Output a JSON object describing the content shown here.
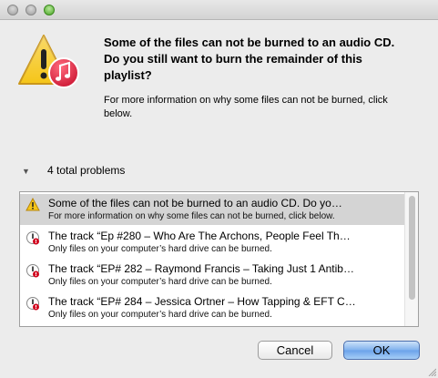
{
  "window": {
    "buttons": [
      "close",
      "minimize",
      "zoom"
    ]
  },
  "dialog": {
    "icon": "caution-triangle-with-music-note-icon",
    "headline_lines": [
      "Some of the files can not be burned to an audio CD.",
      "Do you still want to burn the remainder of this",
      "playlist?"
    ],
    "info_lines": [
      "For more information on why some files can not be burned, click",
      "below."
    ],
    "problems_label": "4 total problems",
    "problems": [
      {
        "icon": "warning-icon",
        "title": "Some of the files can not be burned to an audio CD. Do yo…",
        "detail": "For more information on why some files can not be burned, click below.",
        "selected": true
      },
      {
        "icon": "error-icon",
        "title": "The track “Ep #280 –  Who Are The Archons, People Feel Th…",
        "detail": "Only files on your computer’s hard drive can be burned.",
        "selected": false
      },
      {
        "icon": "error-icon",
        "title": "The track “EP# 282 – Raymond Francis – Taking Just 1 Antib…",
        "detail": "Only files on your computer’s hard drive can be burned.",
        "selected": false
      },
      {
        "icon": "error-icon",
        "title": "The track “EP# 284 – Jessica Ortner – How Tapping & EFT C…",
        "detail": "Only files on your computer’s hard drive can be burned.",
        "selected": false
      }
    ],
    "cancel_label": "Cancel",
    "ok_label": "OK"
  },
  "colors": {
    "accent_button": "#7fb1ed",
    "selection": "#d4d4d4",
    "warning": "#f5c518",
    "error": "#d0021b"
  }
}
